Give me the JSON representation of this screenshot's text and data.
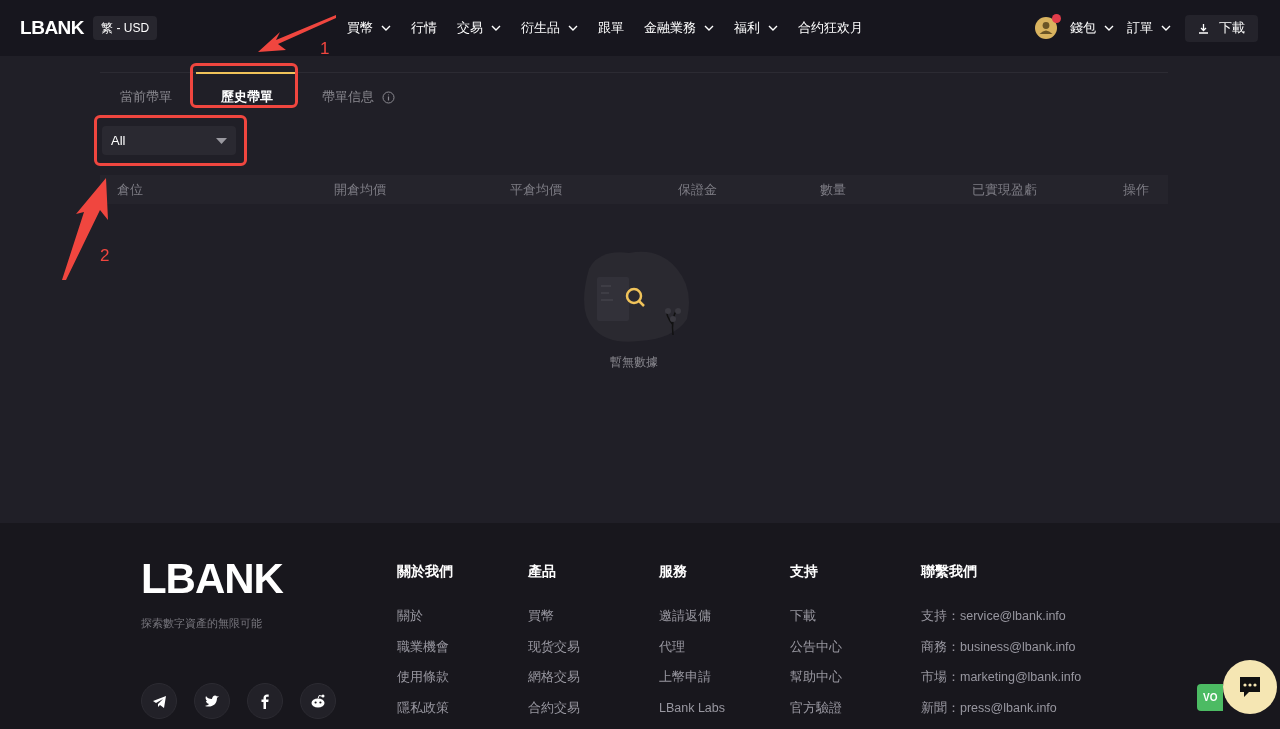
{
  "header": {
    "logo": "LBANK",
    "locale": "繁 - USD",
    "nav": [
      {
        "label": "買幣",
        "has_menu": true
      },
      {
        "label": "行情",
        "has_menu": false
      },
      {
        "label": "交易",
        "has_menu": true
      },
      {
        "label": "衍生品",
        "has_menu": true
      },
      {
        "label": "跟單",
        "has_menu": false
      },
      {
        "label": "金融業務",
        "has_menu": true
      },
      {
        "label": "福利",
        "has_menu": true
      },
      {
        "label": "合约狂欢月",
        "has_menu": false
      }
    ],
    "account": {
      "notification": true
    },
    "right_menus": [
      {
        "label": "錢包",
        "has_menu": true
      },
      {
        "label": "訂單",
        "has_menu": true
      }
    ],
    "download": "下載"
  },
  "tabs": [
    {
      "label": "當前帶單",
      "selected": false,
      "info": false
    },
    {
      "label": "歷史帶單",
      "selected": true,
      "info": false
    },
    {
      "label": "帶單信息",
      "selected": false,
      "info": true
    }
  ],
  "filter": {
    "value": "All"
  },
  "table": {
    "columns": [
      "倉位",
      "開倉均價",
      "平倉均價",
      "保證金",
      "數量",
      "已實現盈虧",
      "操作"
    ],
    "empty_text": "暫無數據"
  },
  "annotations": [
    {
      "label": "1"
    },
    {
      "label": "2"
    }
  ],
  "footer": {
    "logo": "LBANK",
    "tagline": "探索數字資產的無限可能",
    "columns": [
      {
        "title": "關於我們",
        "items": [
          "關於",
          "職業機會",
          "使用條款",
          "隱私政策"
        ]
      },
      {
        "title": "產品",
        "items": [
          "買幣",
          "现货交易",
          "網格交易",
          "合約交易"
        ]
      },
      {
        "title": "服務",
        "items": [
          "邀請返傭",
          "代理",
          "上幣申請",
          "LBank Labs"
        ]
      },
      {
        "title": "支持",
        "items": [
          "下載",
          "公告中心",
          "幫助中心",
          "官方驗證"
        ]
      },
      {
        "title": "聯繫我們",
        "items": [
          "支持：service@lbank.info",
          "商務：business@lbank.info",
          "市場：marketing@lbank.info",
          "新聞：press@lbank.info"
        ]
      }
    ],
    "socials": [
      {
        "kind": "telegram"
      },
      {
        "kind": "twitter"
      },
      {
        "kind": "facebook"
      },
      {
        "kind": "reddit"
      }
    ]
  },
  "feedback_tab": "VO"
}
